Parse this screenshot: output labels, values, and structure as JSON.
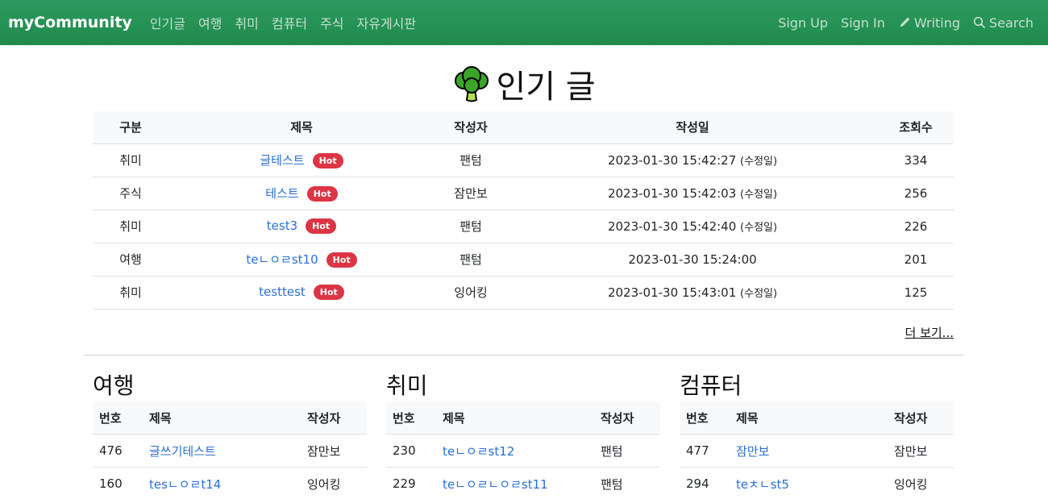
{
  "nav": {
    "brand": "myCommunity",
    "menu": [
      "인기글",
      "여행",
      "취미",
      "컴퓨터",
      "주식",
      "자유게시판"
    ],
    "signup": "Sign Up",
    "signin": "Sign In",
    "writing": "Writing",
    "search": "Search"
  },
  "popular": {
    "title": "인기 글",
    "headers": [
      "구분",
      "제목",
      "작성자",
      "작성일",
      "조회수"
    ],
    "hot_label": "Hot",
    "edited_label": "(수정일)",
    "rows": [
      {
        "category": "취미",
        "title": "글테스트",
        "author": "팬텀",
        "date": "2023-01-30 15:42:27",
        "edited": true,
        "views": "334"
      },
      {
        "category": "주식",
        "title": "테스트",
        "author": "잠만보",
        "date": "2023-01-30 15:42:03",
        "edited": true,
        "views": "256"
      },
      {
        "category": "취미",
        "title": "test3",
        "author": "팬텀",
        "date": "2023-01-30 15:42:40",
        "edited": true,
        "views": "226"
      },
      {
        "category": "여행",
        "title": "teㄴㅇㄹst10",
        "author": "팬텀",
        "date": "2023-01-30 15:24:00",
        "edited": false,
        "views": "201"
      },
      {
        "category": "취미",
        "title": "testtest",
        "author": "잉어킹",
        "date": "2023-01-30 15:43:01",
        "edited": true,
        "views": "125"
      }
    ],
    "more": "더 보기..."
  },
  "boards": [
    {
      "title": "여행",
      "headers": [
        "번호",
        "제목",
        "작성자"
      ],
      "rows": [
        {
          "no": "476",
          "title": "글쓰기테스트",
          "author": "잠만보"
        },
        {
          "no": "160",
          "title": "tesㄴㅇㄹt14",
          "author": "잉어킹"
        }
      ]
    },
    {
      "title": "취미",
      "headers": [
        "번호",
        "제목",
        "작성자"
      ],
      "rows": [
        {
          "no": "230",
          "title": "teㄴㅇㄹst12",
          "author": "팬텀"
        },
        {
          "no": "229",
          "title": "teㄴㅇㄹㄴㅇㄹst11",
          "author": "팬텀"
        }
      ]
    },
    {
      "title": "컴퓨터",
      "headers": [
        "번호",
        "제목",
        "작성자"
      ],
      "rows": [
        {
          "no": "477",
          "title": "잠만보",
          "author": "잠만보"
        },
        {
          "no": "294",
          "title": "teㅊㄴst5",
          "author": "잉어킹"
        }
      ]
    }
  ],
  "colors": {
    "navbar": "#1f8a4c",
    "link": "#2a6fd6",
    "hot_badge": "#dc3545"
  }
}
